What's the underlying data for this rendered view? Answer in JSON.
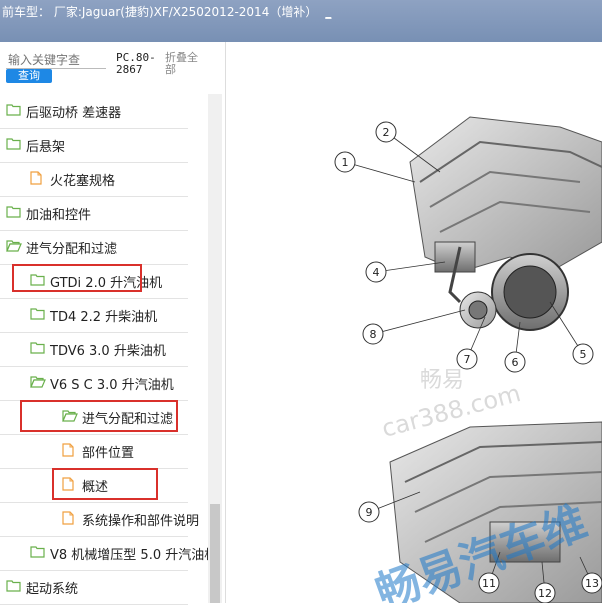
{
  "header": {
    "title": "前车型：  厂家:Jaguar(捷豹)XF/X2502012-2014（增补）",
    "link": "_"
  },
  "search": {
    "placeholder": "输入关键字查",
    "button": "查询",
    "pc_label": "PC.80-\n2867",
    "fold_label": "折叠全部"
  },
  "tree": {
    "items": [
      {
        "label": "后驱动桥 差速器",
        "icon": "folder-icon"
      },
      {
        "label": "后悬架",
        "icon": "folder-icon"
      },
      {
        "label": "火花塞规格",
        "icon": "document-icon"
      },
      {
        "label": "加油和控件",
        "icon": "folder-icon"
      },
      {
        "label": "进气分配和过滤",
        "icon": "folder-open-icon"
      },
      {
        "label": "GTDi 2.0 升汽油机",
        "icon": "folder-icon"
      },
      {
        "label": "TD4 2.2 升柴油机",
        "icon": "folder-icon"
      },
      {
        "label": "TDV6 3.0 升柴油机",
        "icon": "folder-icon"
      },
      {
        "label": "V6 S C 3.0 升汽油机",
        "icon": "folder-open-icon"
      },
      {
        "label": "进气分配和过滤",
        "icon": "folder-open-icon"
      },
      {
        "label": "部件位置",
        "icon": "document-icon"
      },
      {
        "label": "概述",
        "icon": "document-icon"
      },
      {
        "label": "系统操作和部件说明",
        "icon": "document-icon"
      },
      {
        "label": "V8 机械增压型 5.0 升汽油机",
        "icon": "folder-icon"
      },
      {
        "label": "起动系统",
        "icon": "folder-icon"
      }
    ]
  },
  "diagram": {
    "callouts": [
      "1",
      "2",
      "4",
      "8",
      "7",
      "6",
      "5",
      "9",
      "11",
      "12",
      "13"
    ]
  },
  "watermark": {
    "line1": "畅易",
    "line2": "car388.com",
    "line3": "畅易汽车维"
  },
  "colors": {
    "header": "#8ea2c2",
    "highlight": "#d9302b",
    "folder": "#6ab04c",
    "document": "#f0a040",
    "button": "#1e88e5"
  }
}
